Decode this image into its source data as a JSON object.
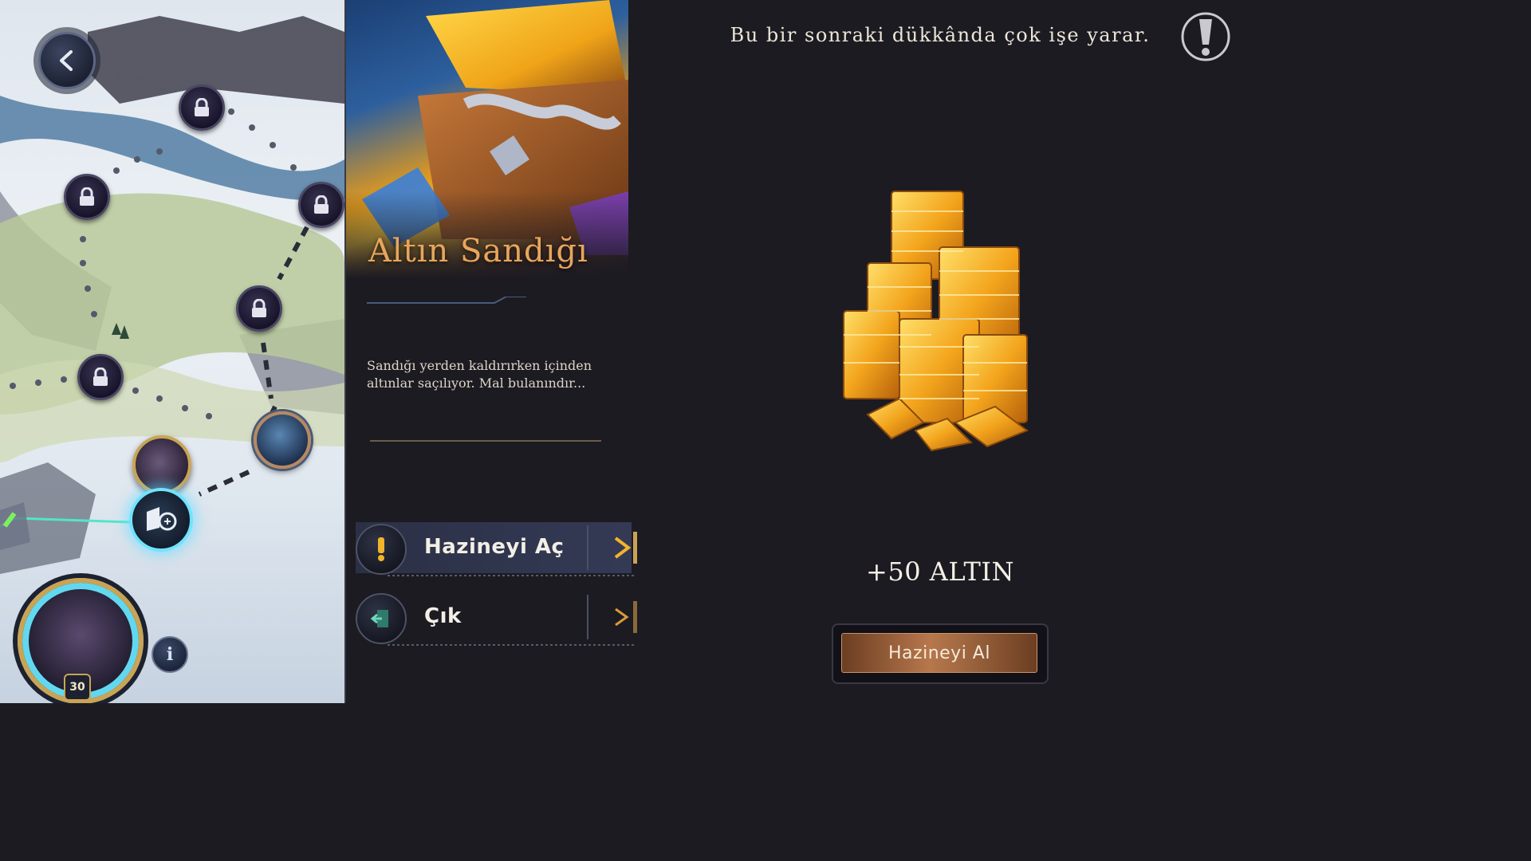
{
  "map": {
    "player_level": "30",
    "info_label": "i"
  },
  "card": {
    "title": "Altın Sandığı",
    "description": "Sandığı yerden kaldırırken içinden altınlar saçılıyor. Mal bulanındır..."
  },
  "options": [
    {
      "label": "Hazineyi Aç",
      "icon": "exclamation-icon"
    },
    {
      "label": "Çık",
      "icon": "exit-door-icon"
    }
  ],
  "tip": {
    "text": "Bu bir sonraki dükkânda çok işe yarar."
  },
  "reward": {
    "text": "+50 ALTIN",
    "button_label": "Hazineyi Al"
  },
  "colors": {
    "background": "#1c1b22",
    "title_accent": "#e8a55c",
    "gold": "#f2b42a",
    "node_glow": "#6fe3ff"
  }
}
